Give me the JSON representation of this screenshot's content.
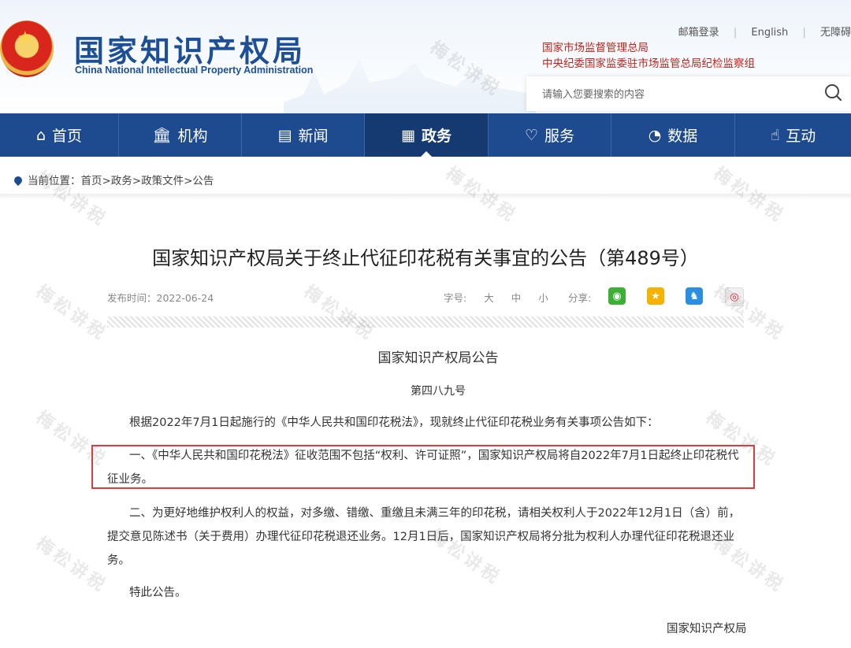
{
  "header": {
    "logo_cn": "国家知识产权局",
    "logo_en": "China National Intellectual Property Administration",
    "top_links": [
      "邮箱登录",
      "English",
      "无障碍"
    ],
    "supervise_lines": [
      "国家市场监督管理总局",
      "中央纪委国家监委驻市场监管总局纪检监察组"
    ],
    "search_placeholder": "请输入您要搜索的内容",
    "accent_color": "#1e4b8f",
    "red_color": "#c0251c"
  },
  "nav": {
    "items": [
      {
        "label": "首页",
        "icon": "home-icon",
        "active": false
      },
      {
        "label": "机构",
        "icon": "bank-icon",
        "active": false
      },
      {
        "label": "新闻",
        "icon": "newspaper-icon",
        "active": false
      },
      {
        "label": "政务",
        "icon": "document-icon",
        "active": true
      },
      {
        "label": "服务",
        "icon": "heart-hand-icon",
        "active": false
      },
      {
        "label": "数据",
        "icon": "pie-chart-icon",
        "active": false
      },
      {
        "label": "互动",
        "icon": "hand-pointer-icon",
        "active": false
      }
    ]
  },
  "breadcrumb": {
    "prefix": "当前位置：",
    "path": "首页>政务>政策文件>公告"
  },
  "article": {
    "title": "国家知识产权局关于终止代征印花税有关事宜的公告（第489号）",
    "date": "发布时间：2022-06-24",
    "font_label": "字号:",
    "font_sizes": [
      "大",
      "中",
      "小"
    ],
    "share_label": "分享:",
    "share_icons": [
      "wechat-icon",
      "qzone-icon",
      "qq-icon",
      "weibo-icon"
    ],
    "doc_heading": "国家知识产权局公告",
    "doc_number": "第四八九号",
    "paragraphs": [
      "根据2022年7月1日起施行的《中华人民共和国印花税法》，现就终止代征印花税业务有关事项公告如下：",
      "一、《中华人民共和国印花税法》征收范围不包括“权利、许可证照”，国家知识产权局将自2022年7月1日起终止印花税代征业务。",
      "二、为更好地维护权利人的权益，对多缴、错缴、重缴且未满三年的印花税，请相关权利人于2022年12月1日（含）前，提交意见陈述书（关于费用）办理代征印花税退还业务。12月1日后，国家知识产权局将分批为权利人办理代征印花税退还业务。",
      "特此公告。"
    ],
    "signer": "国家知识产权局"
  },
  "watermark": "梅松讲税"
}
